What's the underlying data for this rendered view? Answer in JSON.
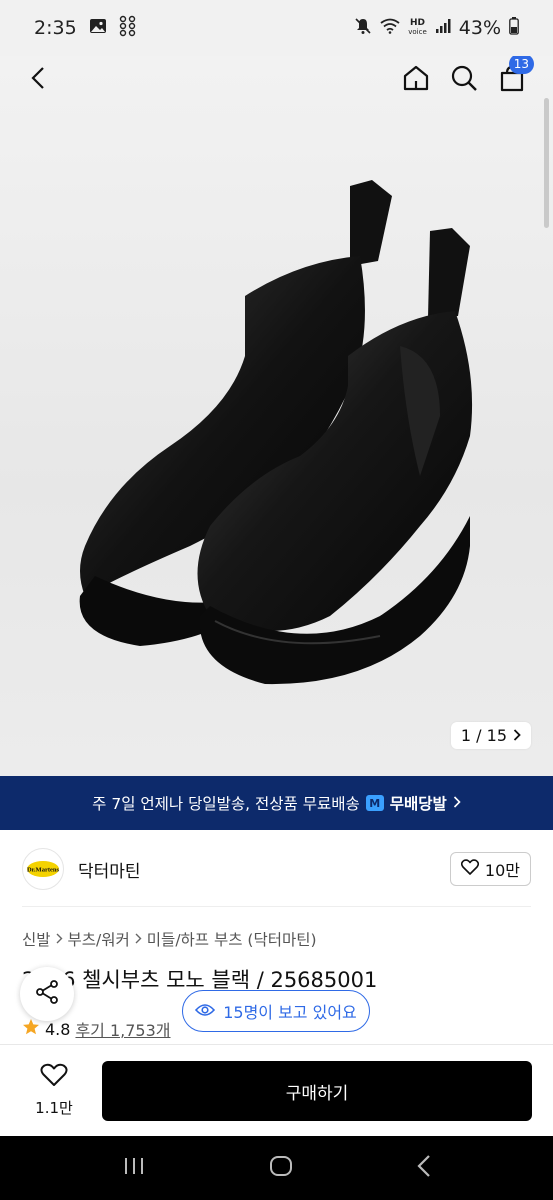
{
  "status_bar": {
    "time": "2:35",
    "battery": "43%",
    "hd_label_top": "HD",
    "hd_label_bottom": "voice"
  },
  "nav": {
    "cart_count": "13",
    "icons": [
      "back-icon",
      "home-icon",
      "search-icon",
      "cart-icon"
    ]
  },
  "gallery": {
    "counter": "1 / 15"
  },
  "banner": {
    "text": "주 7일 언제나 당일발송, 전상품 무료배송",
    "mark": "M",
    "brand": "무배당발"
  },
  "brand": {
    "name": "닥터마틴",
    "logo_text": "Dr.Martens",
    "likes": "10만"
  },
  "breadcrumb": [
    "신발",
    "부츠/워커",
    "미들/하프 부츠 (닥터마틴)"
  ],
  "product": {
    "title": "2976 첼시부츠 모노 블랙 / 25685001",
    "rating": "4.8",
    "reviews": "후기 1,753개",
    "viewing": "15명이 보고 있어요"
  },
  "bottom": {
    "wish_count": "1.1만",
    "buy_label": "구매하기"
  },
  "colors": {
    "banner_bg": "#0d2a6b",
    "accent": "#2f6ae6",
    "buy_bg": "#000000",
    "star": "#f5a623"
  }
}
